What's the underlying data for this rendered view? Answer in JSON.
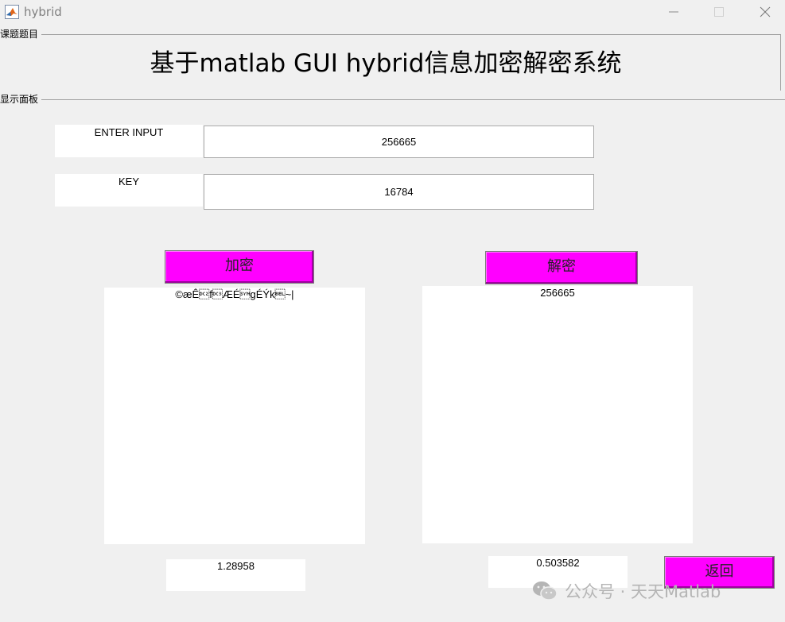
{
  "window": {
    "title": "hybrid"
  },
  "panels": {
    "topic_title": "课题题目",
    "display_title": "显示面板"
  },
  "main_title": "基于matlab GUI hybrid信息加密解密系统",
  "inputs": {
    "enter_input_label": "ENTER INPUT",
    "enter_input_value": "256665",
    "key_label": "KEY",
    "key_value": "16784"
  },
  "buttons": {
    "encrypt": "加密",
    "decrypt": "解密",
    "back": "返回"
  },
  "outputs": {
    "encrypted_text": "©æÊ\u0012f\u0013ÆÉ\u0016gÉÝk\u0007~|",
    "decrypted_text": "256665",
    "encrypt_time": "1.28958",
    "decrypt_time": "0.503582"
  },
  "watermark": {
    "text": "公众号 · 天天Matlab",
    "icon": "wechat-icon"
  },
  "colors": {
    "button_bg": "#ff00ff",
    "window_bg": "#f0f0f0",
    "field_bg": "#ffffff"
  }
}
